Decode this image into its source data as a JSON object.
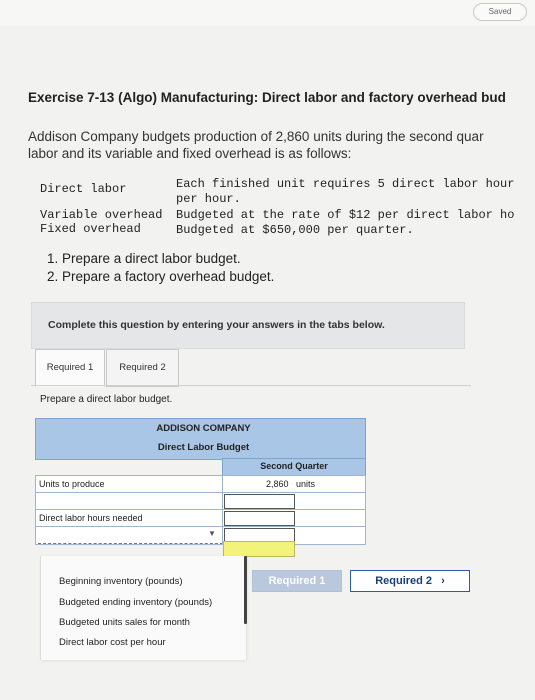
{
  "header": {
    "saved_label": "Saved"
  },
  "exercise": {
    "title": "Exercise 7-13 (Algo) Manufacturing: Direct labor and factory overhead bud",
    "intro_line1": "Addison Company budgets production of 2,860 units during the second quar",
    "intro_line2": "labor and its variable and fixed overhead is as follows:",
    "spec": [
      {
        "label": "Direct labor",
        "text": "Each finished unit requires 5 direct labor hour"
      },
      {
        "label": "",
        "text": "per hour."
      },
      {
        "label": "Variable overhead",
        "text": "Budgeted at the rate of $12 per direct labor ho"
      },
      {
        "label": "Fixed overhead",
        "text": "Budgeted at $650,000 per quarter."
      }
    ],
    "requirements": [
      "1. Prepare a direct labor budget.",
      "2. Prepare a factory overhead budget."
    ]
  },
  "panel": {
    "instruction": "Complete this question by entering your answers in the tabs below."
  },
  "tabs": [
    {
      "label": "Required 1",
      "active": true
    },
    {
      "label": "Required 2",
      "active": false
    }
  ],
  "tab_content": {
    "instruction": "Prepare a direct labor budget."
  },
  "table": {
    "company": "ADDISON COMPANY",
    "title": "Direct Labor Budget",
    "column_header": "Second Quarter",
    "rows": [
      {
        "label": "Units to produce",
        "value": "2,860",
        "unit": "units"
      },
      {
        "label": "Direct labor hours needed",
        "value": "",
        "unit": ""
      }
    ]
  },
  "dropdown_options": [
    "Beginning inventory (pounds)",
    "Budgeted ending inventory (pounds)",
    "Budgeted units sales for month",
    "Direct labor cost per hour"
  ],
  "nav": {
    "prev_label": "Required 1",
    "next_label": "Required 2",
    "next_icon": "›"
  }
}
